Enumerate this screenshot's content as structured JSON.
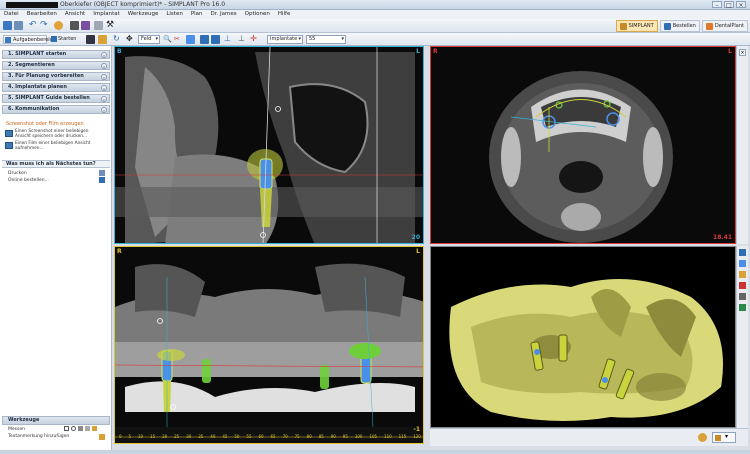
{
  "window": {
    "title": "Oberkiefer (OBJECT komprimiert)* - SIMPLANT Pro 16.0",
    "controls": [
      "–",
      "□",
      "×"
    ]
  },
  "menu": [
    "Datei",
    "Bearbeiten",
    "Ansicht",
    "Implantat",
    "Werkzeuge",
    "Listen",
    "Plan",
    "Dr. James",
    "Optionen",
    "Hilfe"
  ],
  "toolbar": {
    "tasks_label": "Aufgabenbereich",
    "views_label": "Starten",
    "field_label": "Feld",
    "implant_select": "Implantate",
    "size_select": "55"
  },
  "right_tabs": [
    {
      "label": "SIMPLANT",
      "active": true
    },
    {
      "label": "Bestellen",
      "active": false
    },
    {
      "label": "DentalPlant",
      "active": false
    }
  ],
  "steps": [
    "1. SIMPLANT starten",
    "2. Segmentieren",
    "3. Für Planung vorbereiten",
    "4. Implantate planen",
    "5. SIMPLANT Guide bestellen",
    "6. Kommunikation"
  ],
  "communication": {
    "title": "Screenshot oder Film erzeugen",
    "items": [
      "Einen Screenshot einer beliebigen Ansicht speichern oder drucken...",
      "Einen Film einer beliebigen Ansicht aufnehmen..."
    ]
  },
  "what_next": {
    "title": "Was muss ich als Nächstes tun?",
    "items": [
      "Drucken",
      "Online bestellen..."
    ]
  },
  "tools": {
    "title": "Werkzeuge",
    "items": [
      "Messen",
      "Textanmerkung hinzufügen"
    ]
  },
  "viewports": {
    "cross": {
      "left": "B",
      "right": "L",
      "value": "20"
    },
    "axial": {
      "left": "R",
      "right": "L",
      "value": "18.41"
    },
    "pano": {
      "left": "R",
      "right": "L",
      "value": "-1"
    },
    "render": {}
  },
  "pano_ruler": [
    "0",
    "5",
    "10",
    "15",
    "20",
    "25",
    "30",
    "35",
    "40",
    "45",
    "50",
    "55",
    "60",
    "65",
    "70",
    "75",
    "80",
    "85",
    "90",
    "95",
    "100",
    "105",
    "110",
    "115",
    "120"
  ],
  "colors": {
    "cross_border": "#39b0d6",
    "axial_border": "#d8393b",
    "pano_border": "#e0c634",
    "implant_blue": "#4a8fe8",
    "implant_yellow": "#c9d43c",
    "nerve_green": "#6fcf3a",
    "bone_yellow": "#d9d97a"
  }
}
